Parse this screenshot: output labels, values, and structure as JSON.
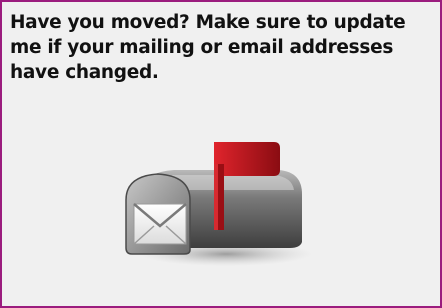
{
  "notice": {
    "message": "Have you moved?  Make sure to update\nme if your mailing or email addresses\nhave changed."
  },
  "illustration": {
    "icon": "mailbox-icon",
    "colors": {
      "border": "#9b1c7e",
      "background": "#f0f0f0",
      "mailbox_body": "#6e6e6e",
      "flag": "#c0141c",
      "envelope": "#ffffff"
    }
  }
}
